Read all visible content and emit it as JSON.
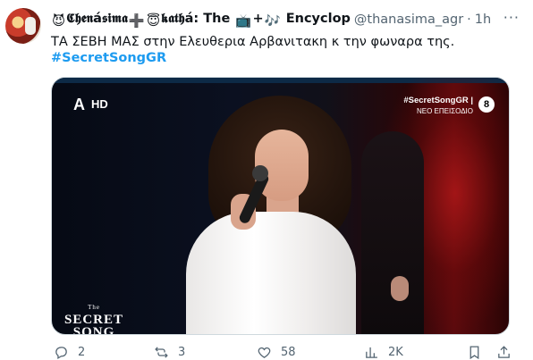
{
  "tweet": {
    "display_name": "𝕮𝖍𝖊𝖓á𝖘𝖎𝖒𝖆",
    "display_name_part2": "𝖐𝖆𝖙𝖍á: The",
    "display_name_part3": "Encyclop",
    "emoji_devil": "😈",
    "emoji_plus": "➕",
    "emoji_halo": "😇",
    "emoji_tv": "📺",
    "emoji_plus2": "+",
    "emoji_music": "🎶",
    "handle": "@thanasima_agr",
    "separator": "·",
    "time": "1h",
    "more": "···",
    "text": "ΤΑ ΣΕΒΗ ΜΑΣ στην Ελευθερια Αρβανιτακη κ την φωναρα της.",
    "hashtag": "#SecretSongGR"
  },
  "media": {
    "channel_logo": "A",
    "channel_hd": "HD",
    "tag_line1": "#SecretSongGR |",
    "tag_line2": "ΝΕΟ ΕΠΕΙΣΟΔΙΟ",
    "age_rating": "8",
    "show_logo_the": "The",
    "show_logo_line1": "SECRET",
    "show_logo_line2": "SONG"
  },
  "actions": {
    "reply_count": "2",
    "retweet_count": "3",
    "like_count": "58",
    "views_count": "2K"
  },
  "colors": {
    "accent": "#1d9bf0",
    "secondary_text": "#536471",
    "primary_text": "#0f1419"
  },
  "icons": {
    "reply": "reply-icon",
    "retweet": "retweet-icon",
    "like": "heart-icon",
    "views": "views-icon",
    "bookmark": "bookmark-icon",
    "share": "share-icon"
  }
}
